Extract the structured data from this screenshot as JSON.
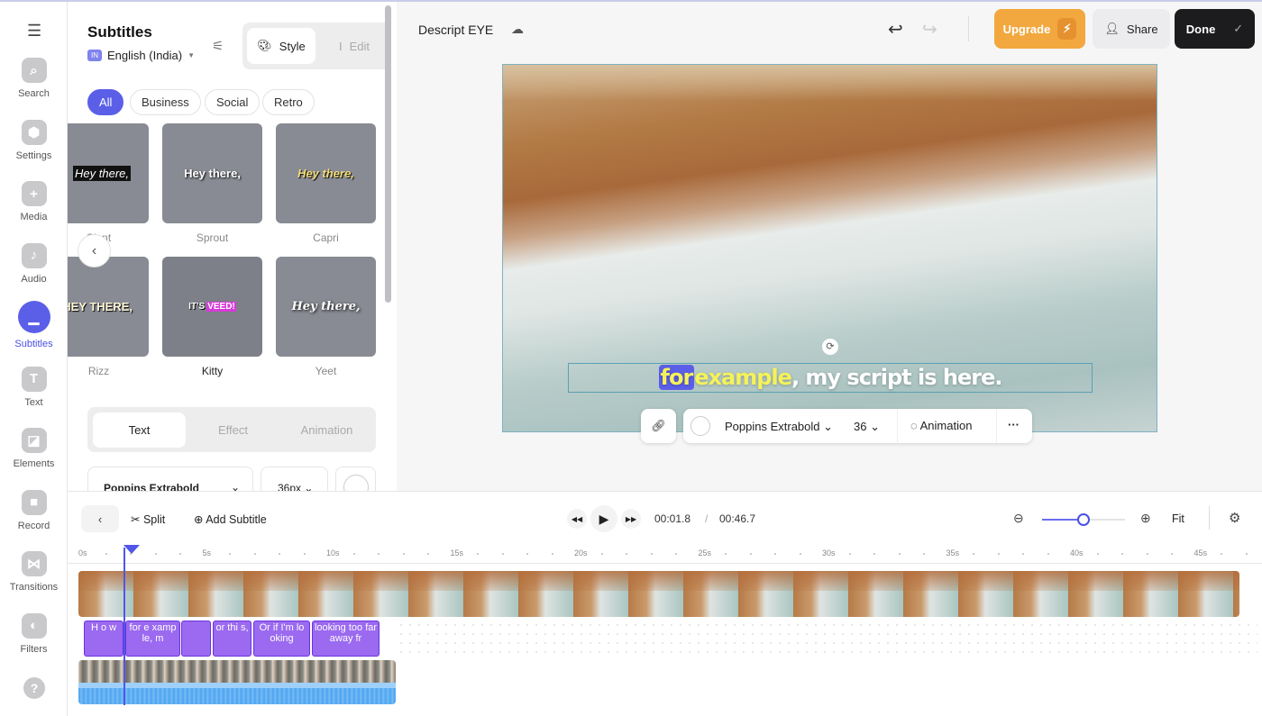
{
  "nav": {
    "items": [
      {
        "label": "Search",
        "icon": "search-icon"
      },
      {
        "label": "Settings",
        "icon": "settings-icon"
      },
      {
        "label": "Media",
        "icon": "plus-icon"
      },
      {
        "label": "Audio",
        "icon": "music-icon"
      },
      {
        "label": "Subtitles",
        "icon": "subtitles-icon",
        "active": true
      },
      {
        "label": "Text",
        "icon": "text-icon"
      },
      {
        "label": "Elements",
        "icon": "elements-icon"
      },
      {
        "label": "Record",
        "icon": "record-icon"
      },
      {
        "label": "Transitions",
        "icon": "transitions-icon"
      },
      {
        "label": "Filters",
        "icon": "filters-icon"
      }
    ],
    "help": "?"
  },
  "panel": {
    "title": "Subtitles",
    "language_badge": "IN",
    "language": "English (India)",
    "mode_tabs": [
      "Style",
      "Edit"
    ],
    "active_mode": "Style",
    "filters": [
      "All",
      "Business",
      "Social",
      "Retro"
    ],
    "active_filter": "All",
    "styles": [
      {
        "name": "Slant",
        "preview": "Hey there,"
      },
      {
        "name": "Sprout",
        "preview": "Hey there,"
      },
      {
        "name": "Capri",
        "preview": "Hey there,"
      },
      {
        "name": "Rizz",
        "preview": "HEY THERE,"
      },
      {
        "name": "Kitty",
        "preview": "IT'S",
        "preview_highlight": "VEED!"
      },
      {
        "name": "Yeet",
        "preview": "Hey there,"
      }
    ],
    "selected_style": "Kitty",
    "prop_tabs": [
      "Text",
      "Effect",
      "Animation"
    ],
    "active_prop_tab": "Text",
    "font": "Poppins Extrabold",
    "font_size": "36px"
  },
  "header": {
    "project": "Descript EYE",
    "upgrade": "Upgrade",
    "share": "Share",
    "done": "Done"
  },
  "canvas": {
    "caption_highlight": "for",
    "caption_keyword": "example",
    "caption_rest": ", my script is here.",
    "highlight_color": "#5b5fe8",
    "keyword_color": "#f5f25a"
  },
  "toolbar": {
    "font": "Poppins Extrabold",
    "size": "36",
    "animation": "Animation"
  },
  "timeline": {
    "split": "Split",
    "add_subtitle": "Add Subtitle",
    "current_time": "00:01.8",
    "separator": "/",
    "total_time": "00:46.7",
    "fit": "Fit",
    "zoom_level": 0.5,
    "ticks": [
      "0s",
      "5s",
      "10s",
      "15s",
      "20s",
      "25s",
      "30s",
      "35s",
      "40s",
      "45s"
    ],
    "clips": [
      "H o w",
      "for e xamp le, m",
      "",
      "or thi s,",
      "Or if I'm lo oking",
      "looking too far away fr"
    ]
  }
}
